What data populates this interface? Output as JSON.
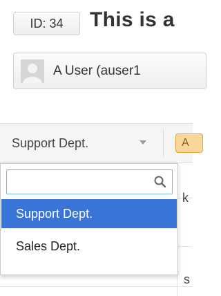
{
  "header": {
    "id_badge": "ID: 34",
    "title": "This is a"
  },
  "user": {
    "display": "A User (auser1"
  },
  "toolbar": {
    "department_selected": "Support Dept.",
    "orange_button_label": "A"
  },
  "dropdown": {
    "search_value": "",
    "options": [
      {
        "label": "Support Dept.",
        "selected": true
      },
      {
        "label": "Sales Dept.",
        "selected": false
      }
    ]
  },
  "table": {
    "fragment_1": "k",
    "fragment_2": "s"
  },
  "colors": {
    "selected_option": "#3875d7",
    "search_focus_border": "#74b6e6",
    "orange_button": "#f7d79a"
  },
  "icons": [
    "search-icon",
    "chevron-down-icon",
    "avatar-placeholder"
  ]
}
